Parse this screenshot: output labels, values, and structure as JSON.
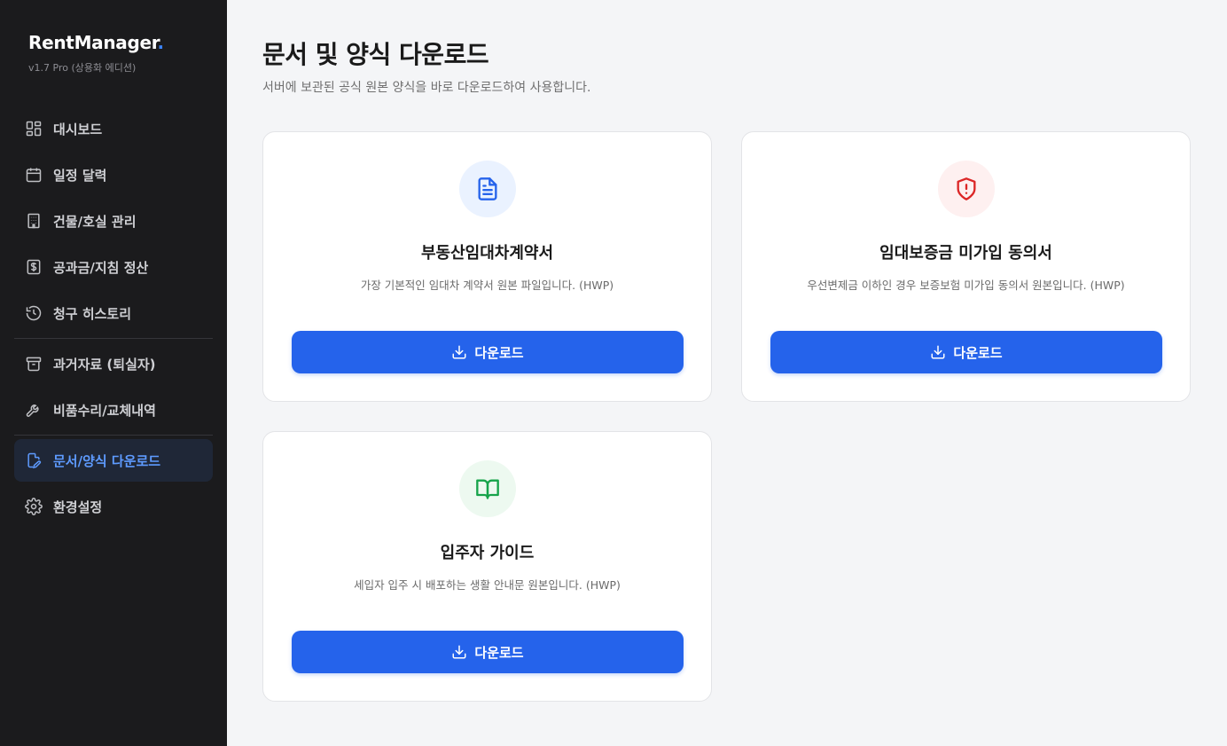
{
  "sidebar": {
    "brand": {
      "name": "RentManager",
      "dot": ".",
      "version": "v1.7 Pro (상용화 에디션)"
    },
    "items": [
      {
        "label": "대시보드",
        "icon": "dashboard-icon"
      },
      {
        "label": "일정 달력",
        "icon": "calendar-icon"
      },
      {
        "label": "건물/호실 관리",
        "icon": "building-icon"
      },
      {
        "label": "공과금/지침 정산",
        "icon": "receipt-dollar-icon"
      },
      {
        "label": "청구 히스토리",
        "icon": "history-icon"
      },
      {
        "label": "과거자료 (퇴실자)",
        "icon": "archive-icon"
      },
      {
        "label": "비품수리/교체내역",
        "icon": "wrench-icon"
      },
      {
        "label": "문서/양식 다운로드",
        "icon": "file-edit-icon",
        "active": true
      },
      {
        "label": "환경설정",
        "icon": "gear-icon"
      }
    ]
  },
  "main": {
    "title": "문서 및 양식 다운로드",
    "subtitle": "서버에 보관된 공식 원본 양식을 바로 다운로드하여 사용합니다.",
    "cards": [
      {
        "title": "부동산임대차계약서",
        "desc": "가장 기본적인 임대차 계약서 원본 파일입니다. (HWP)",
        "button": "다운로드",
        "icon": "document-icon",
        "icon_color": "#2563eb",
        "icon_bg": "#eaf2ff"
      },
      {
        "title": "임대보증금 미가입 동의서",
        "desc": "우선변제금 이하인 경우 보증보험 미가입 동의서 원본입니다. (HWP)",
        "button": "다운로드",
        "icon": "shield-alert-icon",
        "icon_color": "#dc2626",
        "icon_bg": "#fef0f0"
      },
      {
        "title": "입주자 가이드",
        "desc": "세입자 입주 시 배포하는 생활 안내문 원본입니다. (HWP)",
        "button": "다운로드",
        "icon": "book-open-icon",
        "icon_color": "#16a34a",
        "icon_bg": "#edf9f0"
      }
    ]
  },
  "colors": {
    "sidebar_bg": "#1b1b1d",
    "active_item_bg": "#1f2737",
    "active_item_text": "#5e9bff",
    "primary": "#2563eb"
  }
}
